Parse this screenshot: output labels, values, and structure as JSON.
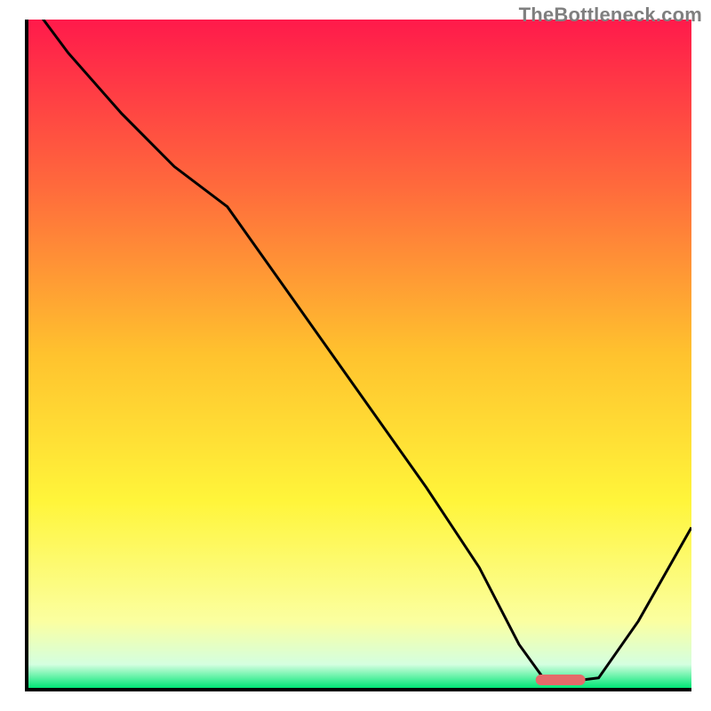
{
  "watermark": "TheBottleneck.com",
  "chart_data": {
    "type": "line",
    "title": "",
    "xlabel": "",
    "ylabel": "",
    "xlim": [
      0,
      100
    ],
    "ylim": [
      0,
      100
    ],
    "background": {
      "type": "vertical-gradient",
      "stops": [
        {
          "pos": 0.0,
          "color": "#ff1a4b"
        },
        {
          "pos": 0.25,
          "color": "#ff6a3c"
        },
        {
          "pos": 0.5,
          "color": "#ffc22e"
        },
        {
          "pos": 0.72,
          "color": "#fff53a"
        },
        {
          "pos": 0.9,
          "color": "#fbffa0"
        },
        {
          "pos": 0.965,
          "color": "#d4ffe0"
        },
        {
          "pos": 1.0,
          "color": "#00e676"
        }
      ]
    },
    "series": [
      {
        "name": "bottleneck-curve",
        "x": [
          0,
          6,
          14,
          22,
          30,
          40,
          50,
          60,
          68,
          74,
          78,
          82,
          86,
          92,
          100
        ],
        "y": [
          103,
          95,
          86,
          78,
          72,
          58,
          44,
          30,
          18,
          6.5,
          1,
          1,
          1.5,
          10,
          24
        ]
      }
    ],
    "markers": [
      {
        "name": "optimal-range",
        "shape": "rounded-bar",
        "color": "#e46a6a",
        "x_range": [
          76.5,
          84
        ],
        "y": 1.2,
        "thickness_pct": 1.6
      }
    ]
  }
}
